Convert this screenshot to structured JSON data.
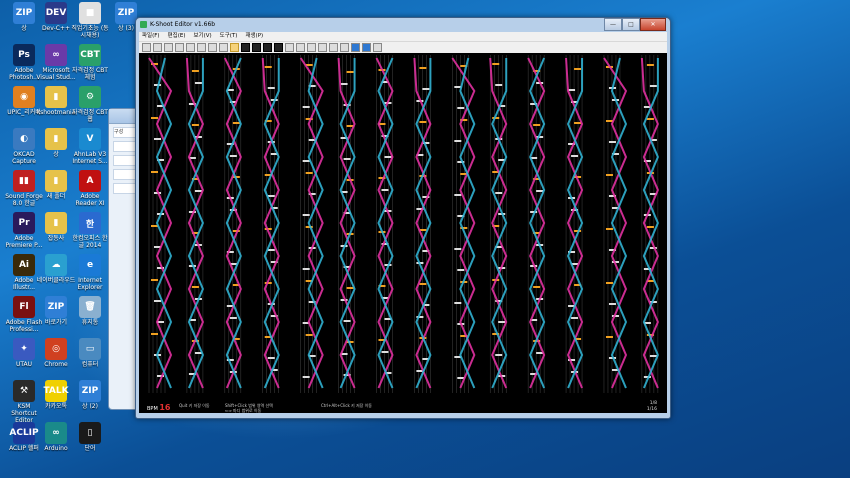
{
  "desktop": {
    "icons": [
      {
        "label": "상",
        "glyph": "ZIP",
        "color": "#2f7fd6",
        "icon": "zip-icon"
      },
      {
        "label": "Dev-C++",
        "glyph": "DEV",
        "color": "#2a3a8a",
        "icon": "devcpp-icon"
      },
      {
        "label": "직업기초능\n(동시채용)",
        "glyph": "■",
        "color": "#e0e0e0",
        "icon": "document-icon"
      },
      {
        "label": "상 (3)",
        "glyph": "ZIP",
        "color": "#2f7fd6",
        "icon": "zip-icon"
      },
      {
        "label": "Adobe Photosh...",
        "glyph": "Ps",
        "color": "#0a2a5c",
        "icon": "photoshop-icon"
      },
      {
        "label": "Microsoft Visual Stud...",
        "glyph": "∞",
        "color": "#6a3aa8",
        "icon": "visualstudio-icon"
      },
      {
        "label": "자격검정 CBT 체험",
        "glyph": "CBT",
        "color": "#2aa06a",
        "icon": "cbt-icon"
      },
      {
        "label": "UPIC_리커버",
        "glyph": "◉",
        "color": "#e08020",
        "icon": "upic-icon"
      },
      {
        "label": "kshootmania",
        "glyph": "▮",
        "color": "#e6c24a",
        "icon": "folder-icon"
      },
      {
        "label": "자격검정 CBT 웹",
        "glyph": "⚙",
        "color": "#2aa06a",
        "icon": "cbt-web-icon"
      },
      {
        "label": "OKCAD Capture",
        "glyph": "◐",
        "color": "#3a7ac0",
        "icon": "okcad-icon"
      },
      {
        "label": "상",
        "glyph": "▮",
        "color": "#e6c24a",
        "icon": "folder-icon"
      },
      {
        "label": "AhnLab V3 Internet S...",
        "glyph": "V",
        "color": "#1a8ad0",
        "icon": "v3-icon"
      },
      {
        "label": "Sound Forge 8.0 한글",
        "glyph": "▮▮",
        "color": "#c02020",
        "icon": "soundforge-icon"
      },
      {
        "label": "새 폴더",
        "glyph": "▮",
        "color": "#e6c24a",
        "icon": "folder-icon"
      },
      {
        "label": "Adobe Reader XI",
        "glyph": "A",
        "color": "#c01010",
        "icon": "reader-icon"
      },
      {
        "label": "Adobe Premiere P...",
        "glyph": "Pr",
        "color": "#2a1a5c",
        "icon": "premiere-icon"
      },
      {
        "label": "잡동사",
        "glyph": "▮",
        "color": "#e6c24a",
        "icon": "folder-icon"
      },
      {
        "label": "한컴오피스 한글 2014",
        "glyph": "한",
        "color": "#2a6ad0",
        "icon": "hwp-icon"
      },
      {
        "label": "Adobe Illustr...",
        "glyph": "Ai",
        "color": "#3a2a0a",
        "icon": "illustrator-icon"
      },
      {
        "label": "네이버클라우드",
        "glyph": "☁",
        "color": "#2aa0d0",
        "icon": "cloud-icon"
      },
      {
        "label": "Internet Explorer",
        "glyph": "e",
        "color": "#1a7ad6",
        "icon": "ie-icon"
      },
      {
        "label": "Adobe Flash Professi...",
        "glyph": "Fl",
        "color": "#7a1010",
        "icon": "flash-icon"
      },
      {
        "label": "바로가기",
        "glyph": "ZIP",
        "color": "#2f7fd6",
        "icon": "zip-icon"
      },
      {
        "label": "휴지통",
        "glyph": "🗑",
        "color": "#8ab0d0",
        "icon": "recycle-bin-icon"
      },
      {
        "label": "UTAU",
        "glyph": "✦",
        "color": "#3a5ac0",
        "icon": "utau-icon"
      },
      {
        "label": "Chrome",
        "glyph": "◎",
        "color": "#d04020",
        "icon": "chrome-icon"
      },
      {
        "label": "컴퓨터",
        "glyph": "▭",
        "color": "#4a8ac0",
        "icon": "computer-icon"
      },
      {
        "label": "KSM Shortcut Editor",
        "glyph": "⚒",
        "color": "#2a2a2a",
        "icon": "ksm-tool-icon"
      },
      {
        "label": "카카오톡",
        "glyph": "TALK",
        "color": "#f0d000",
        "icon": "kakaotalk-icon"
      },
      {
        "label": "상 (2)",
        "glyph": "ZIP",
        "color": "#2f7fd6",
        "icon": "zip-icon"
      },
      {
        "label": "ACLIP 헬퍼",
        "glyph": "ACLIP",
        "color": "#1a3a9a",
        "icon": "aclip-icon"
      },
      {
        "label": "Arduino",
        "glyph": "∞",
        "color": "#1a8a8a",
        "icon": "arduino-icon"
      },
      {
        "label": "단어",
        "glyph": "▯",
        "color": "#1a1a1a",
        "icon": "kshoot-icon"
      }
    ]
  },
  "explorer": {
    "rows": [
      "구성",
      "",
      "",
      "",
      "",
      ""
    ]
  },
  "window": {
    "title": "K-Shoot Editor v1.66b",
    "menus": [
      "파일(F)",
      "편집(E)",
      "보기(V)",
      "도구(T)",
      "재생(P)"
    ],
    "buttons": {
      "minimize": "—",
      "maximize": "□",
      "close": "✕"
    },
    "toolbar": [
      "new",
      "open",
      "save",
      "cut",
      "copy",
      "paste",
      "undo",
      "redo",
      "insert",
      "fx",
      "bt",
      "laser-l",
      "laser-r",
      "chip",
      "long",
      "slam",
      "camera",
      "zoom",
      "settings",
      "play",
      "stop",
      "preview"
    ],
    "status": {
      "bpm_label": "BPM",
      "bpm_value": "16",
      "col_labels": [
        "Quit 키 저장 이동",
        "Shift+Click 범위 영역 선택",
        "⇐⇒ 마디 범위로 이동",
        "Ctrl+Alt+Click 키 저장 이동"
      ],
      "position": "1/8",
      "measure": "1/16"
    }
  }
}
